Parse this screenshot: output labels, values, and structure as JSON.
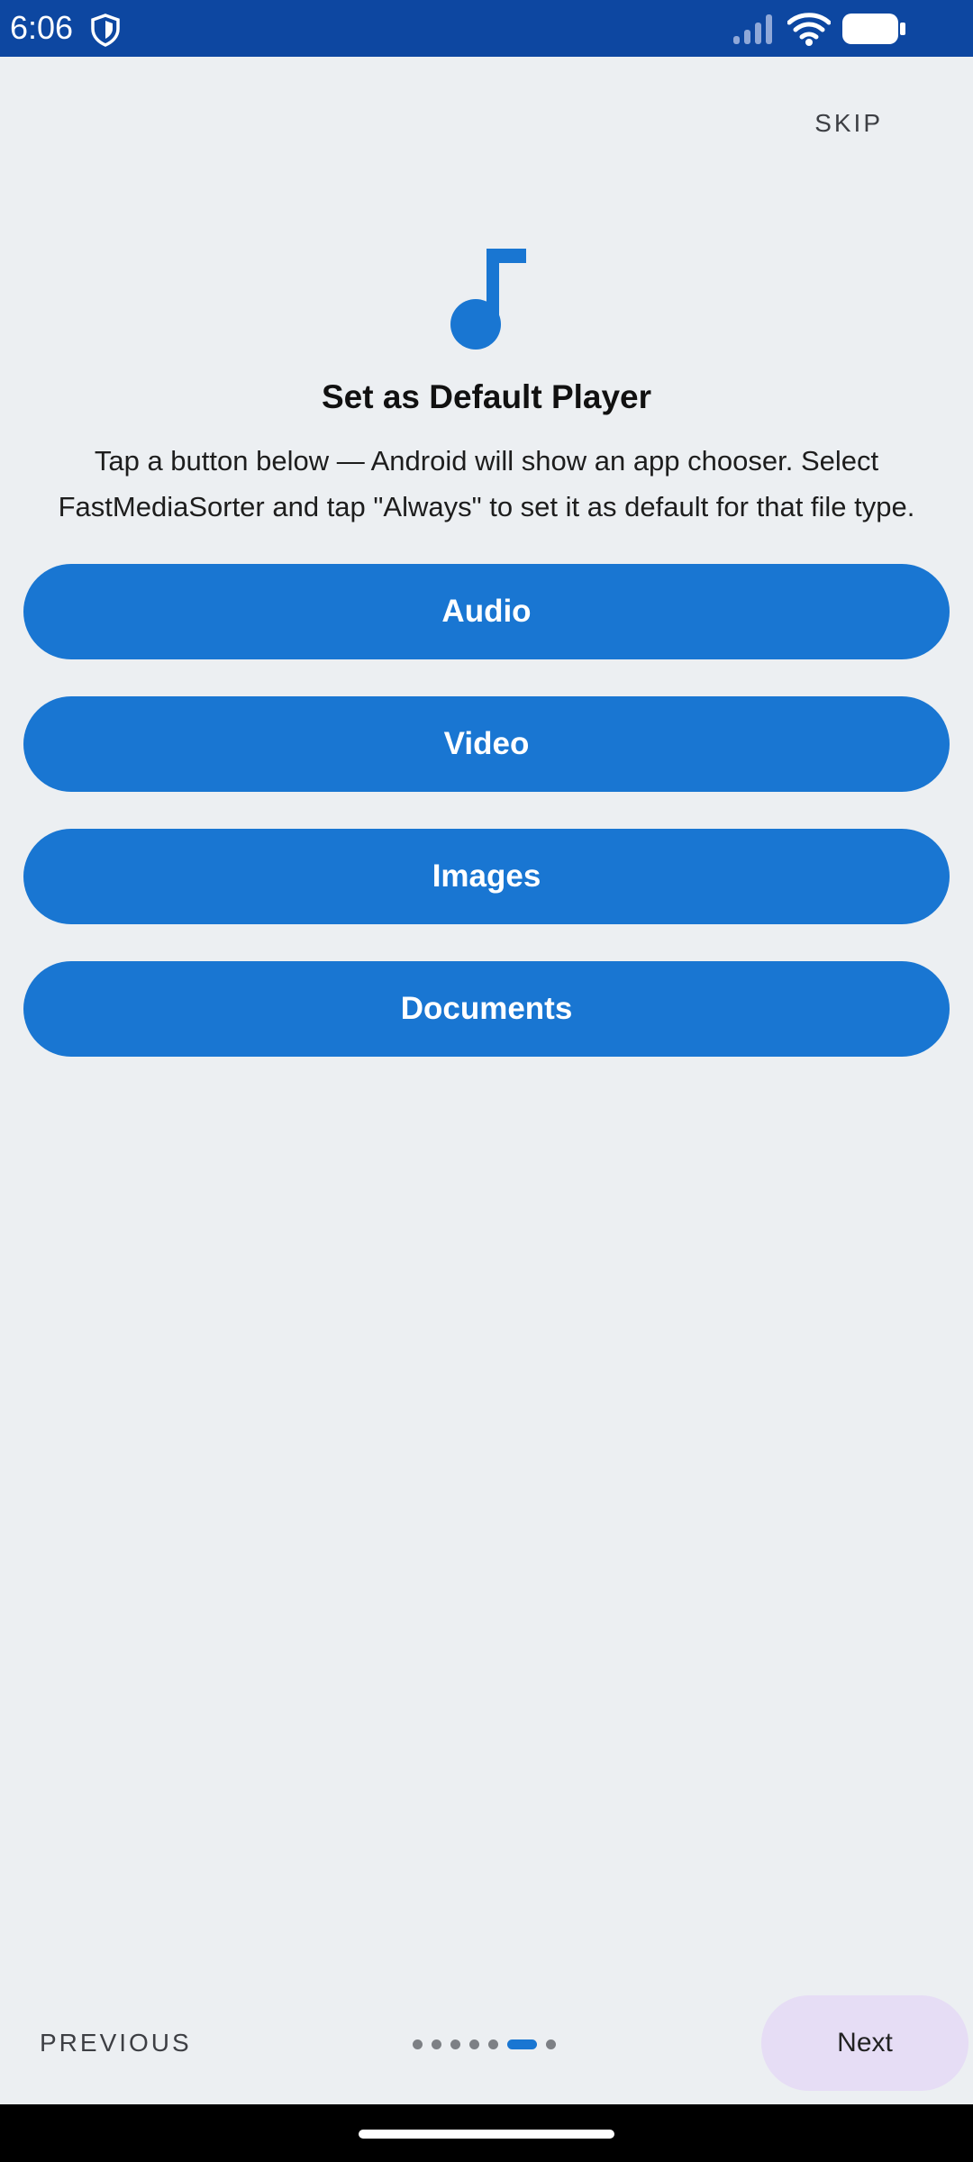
{
  "status_bar": {
    "time": "6:06",
    "icons": [
      "shield-icon",
      "signal-icon",
      "wifi-icon",
      "battery-icon"
    ]
  },
  "header": {
    "skip_label": "SKIP"
  },
  "content": {
    "icon": "music-note-icon",
    "title": "Set as Default Player",
    "description": "Tap a button below — Android will show an app chooser. Select FastMediaSorter and tap \"Always\" to set it as default for that file type.",
    "buttons": {
      "audio": "Audio",
      "video": "Video",
      "images": "Images",
      "documents": "Documents"
    }
  },
  "footer": {
    "previous_label": "PREVIOUS",
    "next_label": "Next",
    "page_count": 7,
    "current_page": 6
  },
  "colors": {
    "status_bar": "#0D47A1",
    "accent": "#1976D2",
    "background": "#ECEFF2",
    "next_button": "#E6DDF5"
  }
}
